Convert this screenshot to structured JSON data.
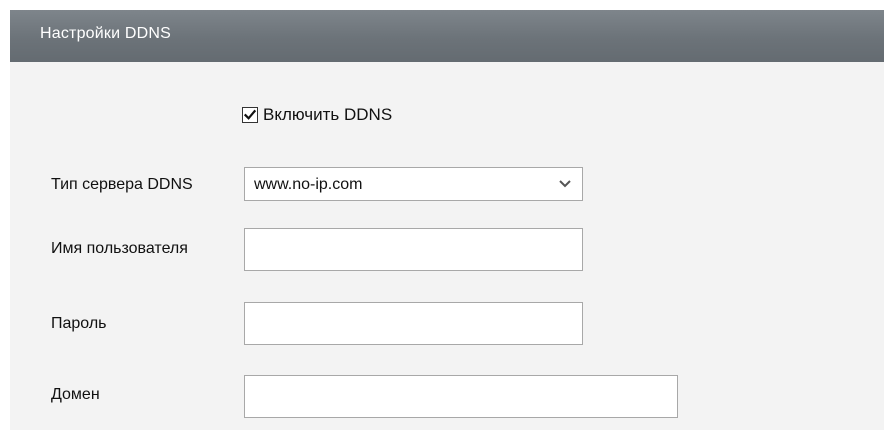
{
  "header": {
    "title": "Настройки DDNS"
  },
  "enable": {
    "checked": true,
    "label": "Включить DDNS"
  },
  "fields": {
    "server_type": {
      "label": "Тип сервера DDNS",
      "value": "www.no-ip.com"
    },
    "username": {
      "label": "Имя пользователя",
      "value": ""
    },
    "password": {
      "label": "Пароль",
      "value": ""
    },
    "domain": {
      "label": "Домен",
      "value": ""
    }
  },
  "icons": {
    "checkbox": "checkmark-icon",
    "select_arrow": "chevron-down-icon"
  },
  "colors": {
    "header_bg": "#6c7379",
    "header_text": "#ffffff",
    "panel_bg": "#f3f3f3",
    "input_border": "#a8a8a8"
  }
}
